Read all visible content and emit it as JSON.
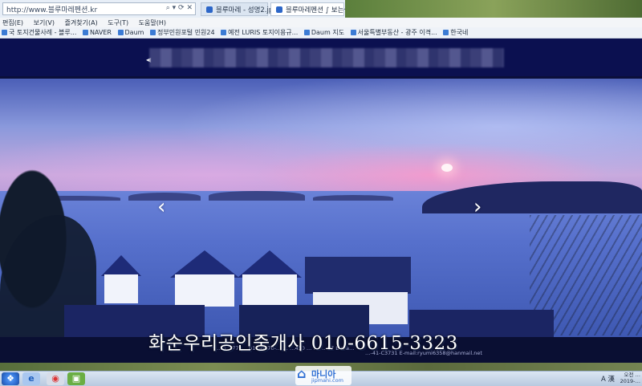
{
  "browser": {
    "address": "http://www.블루마레펜션.kr",
    "tabs": [
      {
        "label": "블루마레 - 성명2.jpg",
        "active": false
      },
      {
        "label": "블루마레펜션 ∫ 보는실 확...",
        "active": true
      }
    ],
    "menu": [
      "편집(E)",
      "보기(V)",
      "즐겨찾기(A)",
      "도구(T)",
      "도움말(H)"
    ],
    "favorites": [
      "국 토지건물사례 - 블루...",
      "NAVER",
      "Daum",
      "정부민원포털 민원24",
      "예전 LURIS 토지이용규...",
      "Daum 지도",
      "서울특별부동산 - 광주 이격...",
      "한국네"
    ]
  },
  "hero": {
    "prev_arrow": "‹",
    "next_arrow": "›",
    "overlay_text": "화순우리공인중개사 010-6615-3323"
  },
  "footer": {
    "info_line1": "…  1…771   …010-6670-…  …   …430  …  …   …-97  E-ma…",
    "info_line2": "…-41-C3731    E-mail:ryumi6358@hanmail.net"
  },
  "taskbar": {
    "tray_text": "A 漢",
    "clock": "오전 … 2019-…",
    "watermark_kor": "마니아",
    "watermark_domain": "jipmani.com"
  },
  "colors": {
    "header_bg": "#0b1050",
    "overlay_text": "#ffffff",
    "info_bar": "#0a0f33"
  }
}
